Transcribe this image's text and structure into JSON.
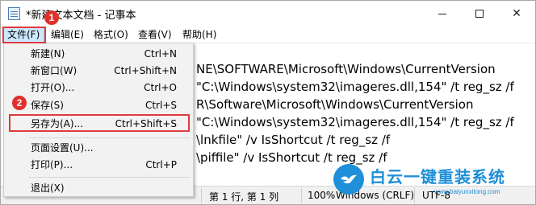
{
  "window": {
    "title": "*新建文本文档 - 记事本",
    "controls": {
      "minimize": "minimize-icon",
      "maximize": "maximize-icon",
      "close": "✕"
    }
  },
  "menubar": {
    "file": "文件(F)",
    "edit": "编辑(E)",
    "format": "格式(O)",
    "view": "查看(V)",
    "help": "帮助(H)"
  },
  "file_menu": {
    "items": [
      {
        "label": "新建(N)",
        "shortcut": "Ctrl+N"
      },
      {
        "label": "新窗口(W)",
        "shortcut": "Ctrl+Shift+N"
      },
      {
        "label": "打开(O)...",
        "shortcut": "Ctrl+O"
      },
      {
        "label": "保存(S)",
        "shortcut": "Ctrl+S"
      },
      {
        "label": "另存为(A)...",
        "shortcut": "Ctrl+Shift+S"
      },
      {
        "label": "页面设置(U)...",
        "shortcut": ""
      },
      {
        "label": "打印(P)...",
        "shortcut": "Ctrl+P"
      },
      {
        "label": "退出(X)",
        "shortcut": ""
      }
    ]
  },
  "editor": {
    "lines": [
      "NE\\SOFTWARE\\Microsoft\\Windows\\CurrentVersion",
      "\"C:\\Windows\\system32\\imageres.dll,154\" /t reg_sz /f",
      "R\\Software\\Microsoft\\Windows\\CurrentVersion",
      "\"C:\\Windows\\system32\\imageres.dll,154\" /t reg_sz /f",
      "\\lnkfile\" /v IsShortcut /t reg_sz /f",
      "\\piffile\" /v IsShortcut /t reg_sz /f"
    ]
  },
  "statusbar": {
    "position": "第 1 行, 第 1 列",
    "zoom": "100%",
    "line_ending": "Windows (CRLF)",
    "encoding": "UTF-8"
  },
  "annotations": {
    "step1": "1",
    "step2": "2",
    "highlight_color": "#e03a3a"
  },
  "watermark": {
    "title": "白云一键重装系统",
    "url": "www.baiyunxitong.com",
    "color": "#1e8fd8"
  }
}
